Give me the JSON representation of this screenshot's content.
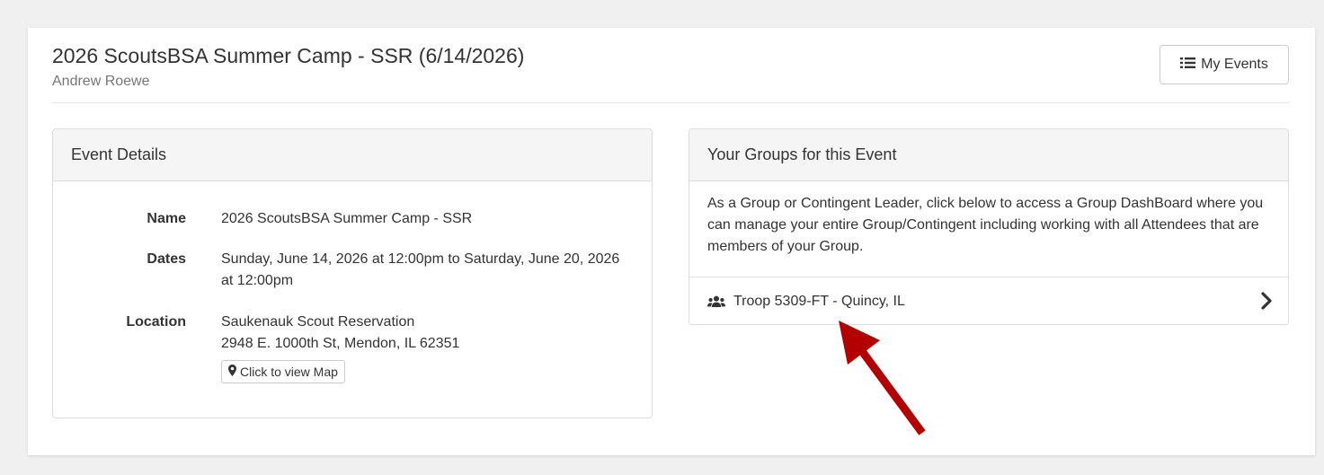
{
  "header": {
    "title": "2026 ScoutsBSA Summer Camp - SSR (6/14/2026)",
    "subtitle": "Andrew Roewe",
    "my_events_label": "My Events"
  },
  "event_details": {
    "heading": "Event Details",
    "name_label": "Name",
    "name_value": "2026 ScoutsBSA Summer Camp - SSR",
    "dates_label": "Dates",
    "dates_value": "Sunday, June 14, 2026 at 12:00pm to Saturday, June 20, 2026 at 12:00pm",
    "location_label": "Location",
    "location_line1": "Saukenauk Scout Reservation",
    "location_line2": "2948 E. 1000th St, Mendon, IL 62351",
    "map_button_label": "Click to view Map"
  },
  "groups": {
    "heading": "Your Groups for this Event",
    "description": "As a Group or Contingent Leader, click below to access a Group DashBoard where you can manage your entire Group/Contingent including working with all Attendees that are members of your Group.",
    "items": [
      {
        "label": "Troop 5309-FT - Quincy, IL"
      }
    ]
  },
  "icons": {
    "list": "list-icon",
    "map_marker": "map-marker-icon",
    "users": "users-icon",
    "chevron": "chevron-right-icon",
    "annotation_arrow": "annotation-arrow-icon"
  },
  "colors": {
    "page_bg": "#f0f0f0",
    "panel_heading_bg": "#f5f5f5",
    "annotation_arrow": "#b30000"
  }
}
